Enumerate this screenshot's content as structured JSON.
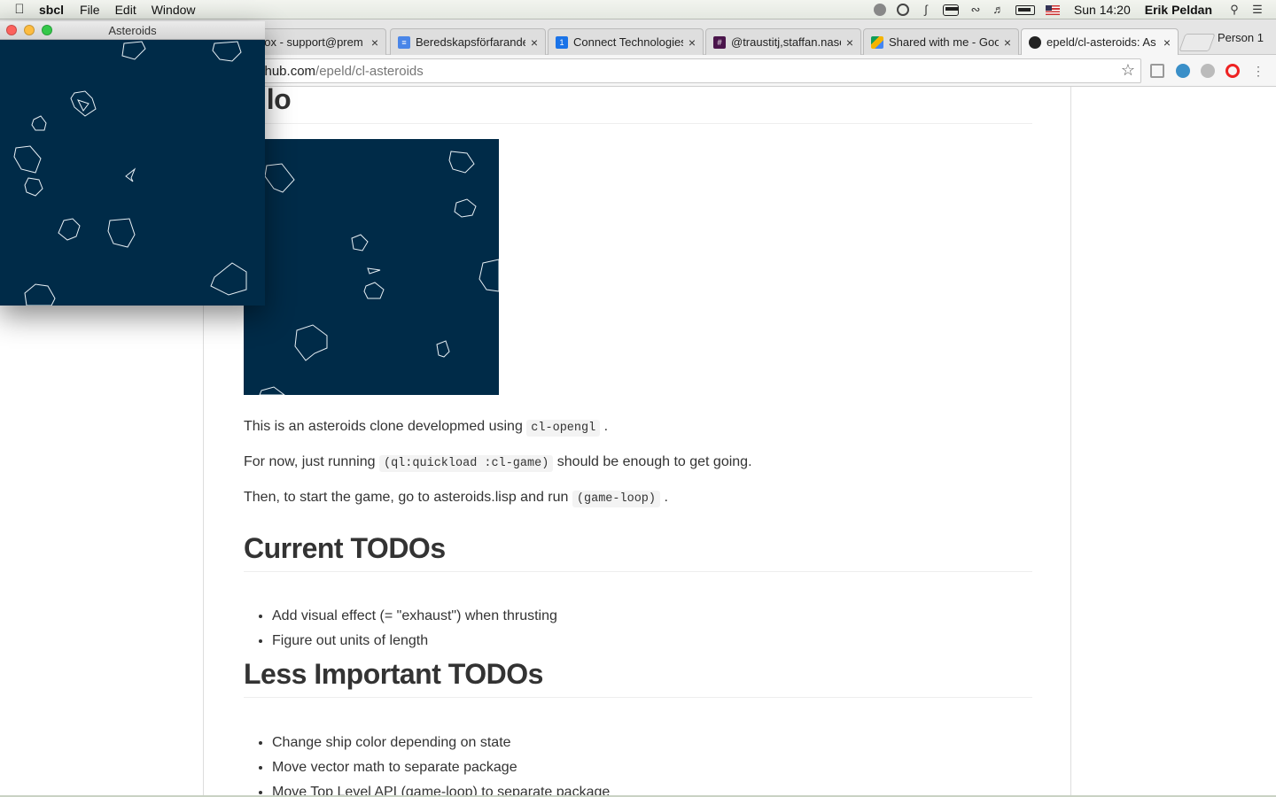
{
  "menubar": {
    "app_name": "sbcl",
    "menus": [
      "File",
      "Edit",
      "Window"
    ],
    "clock": "Sun 14:20",
    "user": "Erik Peldan"
  },
  "browser": {
    "tabs": [
      {
        "label": "box - support@prem",
        "favicon_color": "#cccccc",
        "active": false
      },
      {
        "label": "Beredskapsförfarande",
        "favicon_color": "#4a86e8",
        "active": false
      },
      {
        "label": "Connect Technologies",
        "favicon_color": "#1a73e8",
        "active": false
      },
      {
        "label": "@traustitj,staffan.nase",
        "favicon_color": "#4a154b",
        "active": false
      },
      {
        "label": "Shared with me - Goo",
        "favicon_color": "#f4b400",
        "active": false
      },
      {
        "label": "epeld/cl-asteroids: As",
        "favicon_color": "#222222",
        "active": true
      }
    ],
    "profile": "Person 1",
    "url_host": "ithub.com",
    "url_path": "/epeld/cl-asteroids"
  },
  "readme": {
    "heading": "ello",
    "p1_before": "This is an asteroids clone developmed using",
    "p1_code": "cl-opengl",
    "p1_after": ".",
    "p2_before": "For now, just running",
    "p2_code": "(ql:quickload :cl-game)",
    "p2_after": "should be enough to get going.",
    "p3_before": "Then, to start the game, go to asteroids.lisp and run",
    "p3_code": "(game-loop)",
    "p3_after": ".",
    "current_todos_heading": "Current TODOs",
    "current_todos": [
      "Add visual effect (= \"exhaust\") when thrusting",
      "Figure out units of length"
    ],
    "less_todos_heading": "Less Important TODOs",
    "less_todos": [
      "Change ship color depending on state",
      "Move vector math to separate package",
      "Move Top Level API (game-loop) to separate package"
    ]
  },
  "game_window": {
    "title": "Asteroids",
    "background": "#002b48"
  },
  "colors": {
    "game_bg": "#002b48",
    "close": "#fc615d",
    "minimize": "#fdbc40",
    "zoom": "#34c84a"
  }
}
